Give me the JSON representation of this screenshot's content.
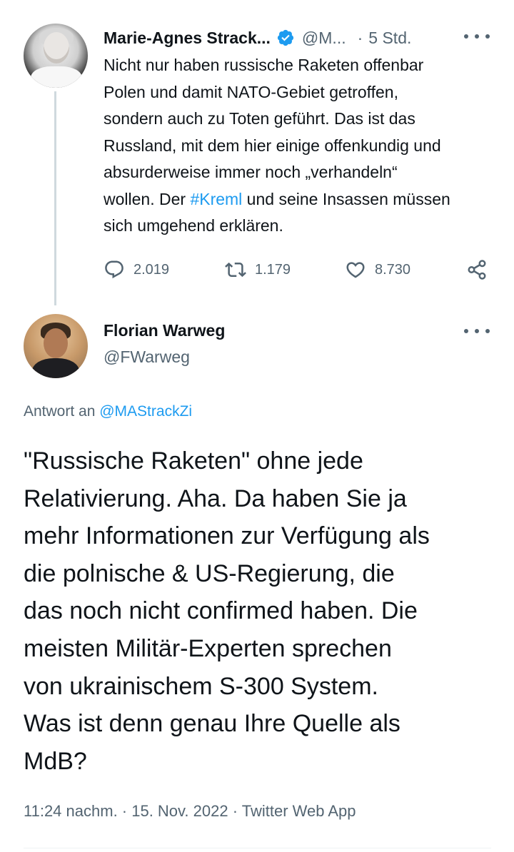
{
  "tweet1": {
    "author_name": "Marie-Agnes Strack...",
    "author_handle": "@M...",
    "separator": "·",
    "time": "5 Std.",
    "lines": [
      "Nicht nur haben russische Raketen offenbar",
      "Polen und damit NATO-Gebiet getroffen,",
      "sondern auch zu Toten geführt. Das ist das",
      "Russland, mit dem hier einige offenkundig und",
      "absurderweise immer noch „verhandeln“"
    ],
    "last_line_before": "wollen. Der ",
    "hashtag": "#Kreml",
    "last_line_after": " und seine Insassen müssen",
    "final_line": "sich umgehend erklären.",
    "replies": "2.019",
    "retweets": "1.179",
    "likes": "8.730"
  },
  "tweet2": {
    "author_name": "Florian Warweg",
    "author_handle": "@FWarweg",
    "reply_prefix": "Antwort an ",
    "reply_mention": "@MAStrackZi",
    "lines": [
      "\"Russische Raketen\" ohne jede",
      "Relativierung. Aha. Da haben Sie ja",
      "mehr Informationen zur Verfügung als",
      "die polnische & US-Regierung, die",
      "das noch nicht confirmed haben. Die",
      "meisten Militär-Experten sprechen",
      "von ukrainischem S-300 System.",
      "Was ist denn genau Ihre Quelle als",
      "MdB?"
    ],
    "meta": "11:24 nachm. · 15. Nov. 2022 · Twitter Web App"
  },
  "colors": {
    "accent": "#1d9bf0",
    "secondary_text": "#536471",
    "thread_line": "#cfd9de"
  },
  "icons": [
    "verified-badge-icon",
    "more-icon",
    "reply-icon",
    "retweet-icon",
    "like-icon",
    "share-icon"
  ]
}
